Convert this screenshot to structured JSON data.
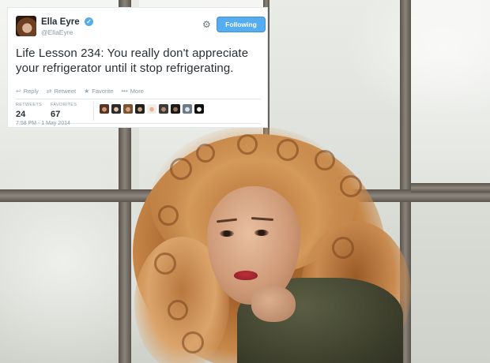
{
  "tweet": {
    "name": "Ella Eyre",
    "handle": "@EllaEyre",
    "follow_label": "Following",
    "text": "Life Lesson 234: You really don't appreciate your refrigerator until it stop refrigerating.",
    "actions": [
      {
        "icon": "reply-icon",
        "glyph": "↩",
        "label": "Reply"
      },
      {
        "icon": "retweet-icon",
        "glyph": "⇄",
        "label": "Retweet"
      },
      {
        "icon": "favorite-icon",
        "glyph": "★",
        "label": "Favorite"
      },
      {
        "icon": "more-icon",
        "glyph": "•••",
        "label": "More"
      }
    ],
    "stats": {
      "retweets_label": "RETWEETS",
      "retweets": "24",
      "favorites_label": "FAVORITES",
      "favorites": "67"
    },
    "timestamp": "7:58 PM - 1 May 2014",
    "colors": {
      "accent": "#55acee",
      "text": "#292f33",
      "muted": "#8899a6"
    }
  }
}
